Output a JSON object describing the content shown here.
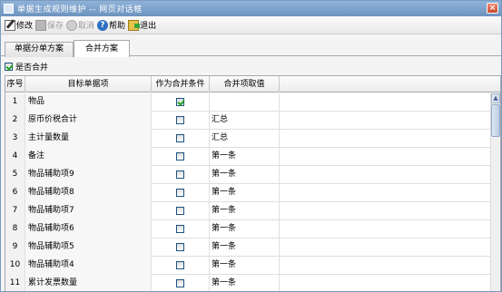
{
  "window": {
    "title": "单据生成规则维护 -- 网页对话框",
    "close_glyph": "×"
  },
  "toolbar": {
    "edit": "修改",
    "save": "保存",
    "cancel": "取消",
    "help": "帮助",
    "help_glyph": "?",
    "exit": "退出"
  },
  "tabs": [
    {
      "label": "单据分单方案",
      "active": false
    },
    {
      "label": "合并方案",
      "active": true
    }
  ],
  "merge_option": {
    "label": "是否合并",
    "checked": true
  },
  "grid": {
    "columns": [
      "序号",
      "目标单据项",
      "作为合并条件",
      "合并项取值"
    ],
    "rows": [
      {
        "no": "1",
        "name": "物品",
        "checked": true,
        "value": ""
      },
      {
        "no": "2",
        "name": "原币价税合计",
        "checked": false,
        "value": "汇总"
      },
      {
        "no": "3",
        "name": "主计量数量",
        "checked": false,
        "value": "汇总"
      },
      {
        "no": "4",
        "name": "备注",
        "checked": false,
        "value": "第一条"
      },
      {
        "no": "5",
        "name": "物品辅助项9",
        "checked": false,
        "value": "第一条"
      },
      {
        "no": "6",
        "name": "物品辅助项8",
        "checked": false,
        "value": "第一条"
      },
      {
        "no": "7",
        "name": "物品辅助项7",
        "checked": false,
        "value": "第一条"
      },
      {
        "no": "8",
        "name": "物品辅助项6",
        "checked": false,
        "value": "第一条"
      },
      {
        "no": "9",
        "name": "物品辅助项5",
        "checked": false,
        "value": "第一条"
      },
      {
        "no": "10",
        "name": "物品辅助项4",
        "checked": false,
        "value": "第一条"
      },
      {
        "no": "11",
        "name": "累计发票数量",
        "checked": false,
        "value": "第一条"
      }
    ]
  },
  "scrollbar": {
    "up_glyph": "▲"
  }
}
